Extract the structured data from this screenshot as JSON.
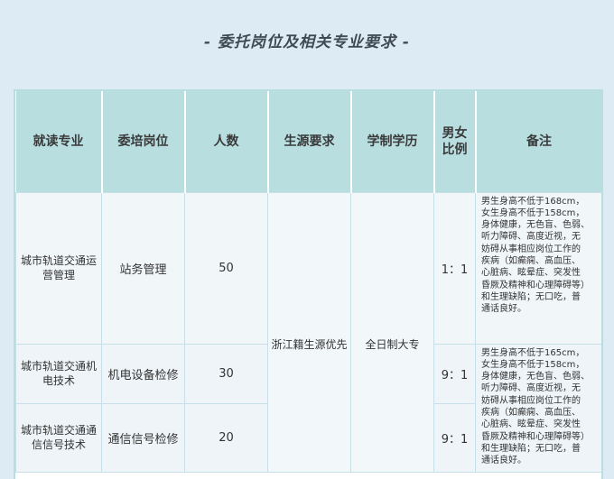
{
  "title": "- 委托岗位及相关专业要求 -",
  "table": {
    "headers": [
      "就读专业",
      "委培岗位",
      "人数",
      "生源要求",
      "学制学历",
      "男女\n比例",
      "备注"
    ],
    "rows": [
      {
        "major": "城市轨道交通运营管理",
        "post": "站务管理",
        "count": "50",
        "ratio": "1：1",
        "note": "男生身高不低于168cm，\n女生身高不低于158cm，\n身体健康，无色盲、色弱、\n听力障碍、高度近视，无\n妨碍从事相应岗位工作的\n疾病（如癫痫、高血压、\n心脏病、眩晕症、突发性\n昏厥及精神和心理障碍等）\n和生理缺陷；无口吃，普\n通话良好。"
      },
      {
        "major": "城市轨道交通机电技术",
        "post": "机电设备检修",
        "count": "30",
        "ratio": "9：1",
        "note": "男生身高不低于165cm，\n女生身高不低于158cm，\n身体健康，无色盲、色弱、\n听力障碍、高度近视，无\n妨碍从事相应岗位工作的\n疾病（如癫痫、高血压、\n心脏病、眩晕症、突发性\n昏厥及精神和心理障碍等）\n和生理缺陷；无口吃，普\n通话良好。"
      },
      {
        "major": "城市轨道交通通信信号技术",
        "post": "通信信号检修",
        "count": "20",
        "ratio": "9：1"
      }
    ],
    "source_requirement": "浙江籍生源优先",
    "education": "全日制大专"
  },
  "colors": {
    "background": "#dcebf4",
    "header_fill": "#b9dee0",
    "row_fill": "#eef4f8"
  }
}
